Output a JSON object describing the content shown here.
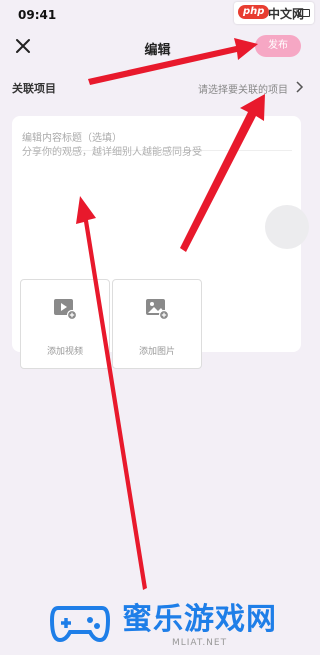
{
  "status_bar": {
    "time": "09:41"
  },
  "site_badge": {
    "php": "php",
    "cn": "中文网"
  },
  "header": {
    "title": "编辑",
    "publish_label": "发布",
    "close_icon": "close-icon"
  },
  "association": {
    "label": "关联项目",
    "hint": "请选择要关联的项目",
    "chevron_icon": "chevron-right-icon"
  },
  "editor": {
    "title_placeholder": "编辑内容标题（选填）",
    "content_placeholder": "分享你的观感，越详细别人越能感同身受"
  },
  "media": [
    {
      "label": "添加视频",
      "icon": "add-video-icon"
    },
    {
      "label": "添加图片",
      "icon": "add-image-icon"
    }
  ],
  "watermark": {
    "title": "蜜乐游戏网",
    "url": "MLIAT.NET"
  },
  "colors": {
    "background": "#f3eff6",
    "publish_button": "#f6a7c4",
    "annotation_arrow": "#e8192c",
    "watermark_blue": "#1e7ee8"
  }
}
